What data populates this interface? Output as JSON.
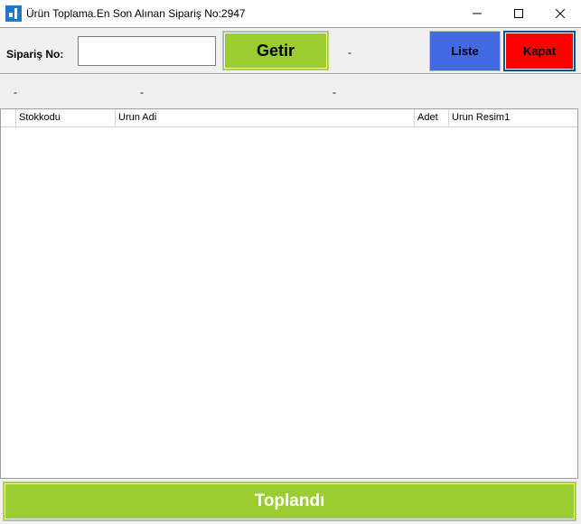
{
  "window": {
    "title": "Ürün Toplama.En Son Alınan Sipariş No:2947",
    "icon": "app-logo-icon",
    "controls": [
      "minimize-icon",
      "maximize-icon",
      "close-icon"
    ]
  },
  "toolbar": {
    "order_label": "Sipariş No:",
    "order_input_value": "",
    "fetch_label": "Getir",
    "status_text": "-",
    "list_label": "Liste",
    "close_label": "Kapat"
  },
  "info": {
    "field1": "-",
    "field2": "-",
    "field3": "-"
  },
  "grid": {
    "columns": [
      "Stokkodu",
      "Urun Adi",
      "Adet",
      "Urun Resim1"
    ],
    "rows": []
  },
  "footer": {
    "collected_label": "Toplandı"
  },
  "colors": {
    "green": "#9acd32",
    "blue": "#4169e1",
    "red": "#ff0000",
    "panel": "#f0f0f0"
  }
}
